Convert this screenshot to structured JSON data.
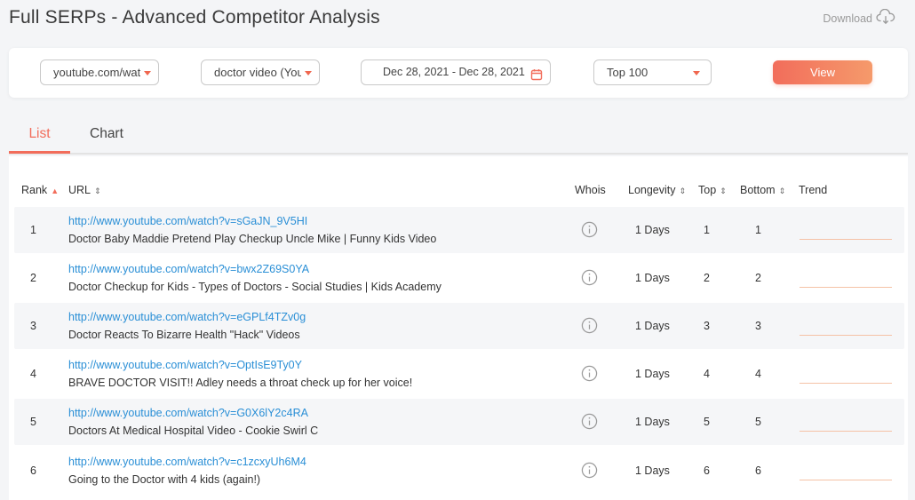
{
  "page": {
    "title": "Full SERPs - Advanced Competitor Analysis",
    "download_label": "Download"
  },
  "filters": {
    "domain": "youtube.com/watch",
    "keyword": "doctor video (YouTube)",
    "date_range": "Dec 28, 2021 - Dec 28, 2021",
    "top": "Top 100",
    "view_label": "View"
  },
  "tabs": [
    {
      "label": "List",
      "active": true
    },
    {
      "label": "Chart",
      "active": false
    }
  ],
  "table": {
    "headers": {
      "rank": "Rank",
      "url": "URL",
      "whois": "Whois",
      "longevity": "Longevity",
      "top": "Top",
      "bottom": "Bottom",
      "trend": "Trend"
    },
    "rows": [
      {
        "rank": "1",
        "url": "http://www.youtube.com/watch?v=sGaJN_9V5HI",
        "title": "Doctor Baby Maddie Pretend Play Checkup Uncle Mike | Funny Kids Video",
        "longevity": "1 Days",
        "top": "1",
        "bottom": "1"
      },
      {
        "rank": "2",
        "url": "http://www.youtube.com/watch?v=bwx2Z69S0YA",
        "title": "Doctor Checkup for Kids - Types of Doctors - Social Studies | Kids Academy",
        "longevity": "1 Days",
        "top": "2",
        "bottom": "2"
      },
      {
        "rank": "3",
        "url": "http://www.youtube.com/watch?v=eGPLf4TZv0g",
        "title": "Doctor Reacts To Bizarre Health \"Hack\" Videos",
        "longevity": "1 Days",
        "top": "3",
        "bottom": "3"
      },
      {
        "rank": "4",
        "url": "http://www.youtube.com/watch?v=OptIsE9Ty0Y",
        "title": "BRAVE DOCTOR VISIT!! Adley needs a throat check up for her voice!",
        "longevity": "1 Days",
        "top": "4",
        "bottom": "4"
      },
      {
        "rank": "5",
        "url": "http://www.youtube.com/watch?v=G0X6lY2c4RA",
        "title": "Doctors At Medical Hospital Video - Cookie Swirl C",
        "longevity": "1 Days",
        "top": "5",
        "bottom": "5"
      },
      {
        "rank": "6",
        "url": "http://www.youtube.com/watch?v=c1zcxyUh6M4",
        "title": "Going to the Doctor with 4 kids (again!)",
        "longevity": "1 Days",
        "top": "6",
        "bottom": "6"
      }
    ]
  },
  "colors": {
    "accent": "#f26d5b",
    "link": "#2a8fd6"
  },
  "icons": {
    "download": "cloud-download-icon",
    "calendar": "calendar-icon",
    "whois": "info-icon",
    "caret": "caret-down-icon"
  }
}
